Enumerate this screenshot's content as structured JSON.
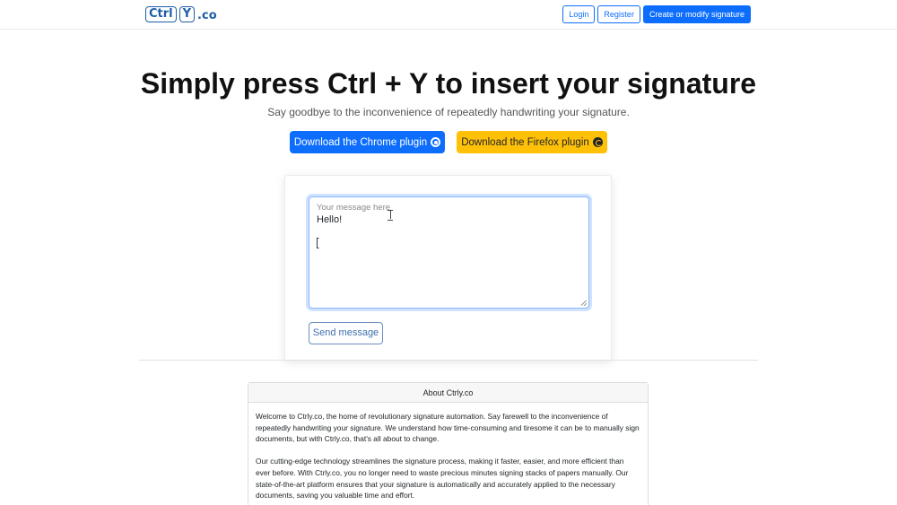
{
  "nav": {
    "logo_key1": "Ctrl",
    "logo_key2": "Y",
    "logo_tld": ".co",
    "login": "Login",
    "register": "Register",
    "create_signature": "Create or modify signature"
  },
  "hero": {
    "title": "Simply press Ctrl + Y to insert your signature",
    "subtitle": "Say goodbye to the inconvenience of repeatedly handwriting your signature.",
    "chrome_button": "Download the Chrome plugin",
    "firefox_button": "Download the Firefox plugin"
  },
  "compose": {
    "placeholder": "Your message here",
    "value": "Hello!",
    "send": "Send message"
  },
  "about": {
    "title": "About Ctrly.co",
    "paragraph1": "Welcome to Ctrly.co, the home of revolutionary signature automation. Say farewell to the inconvenience of repeatedly handwriting your signature. We understand how time-consuming and tiresome it can be to manually sign documents, but with Ctrly.co, that's all about to change.",
    "paragraph2": "Our cutting-edge technology streamlines the signature process, making it faster, easier, and more efficient than ever before. With Ctrly.co, you no longer need to waste precious minutes signing stacks of papers manually. Our state-of-the-art platform ensures that your signature is automatically and accurately applied to the necessary documents, saving you valuable time and effort."
  },
  "colors": {
    "primary": "#0d6efd",
    "warning": "#ffc107",
    "logo": "#1f5fa8"
  },
  "icons": {
    "chrome": "chrome-icon",
    "firefox": "firefox-icon"
  }
}
